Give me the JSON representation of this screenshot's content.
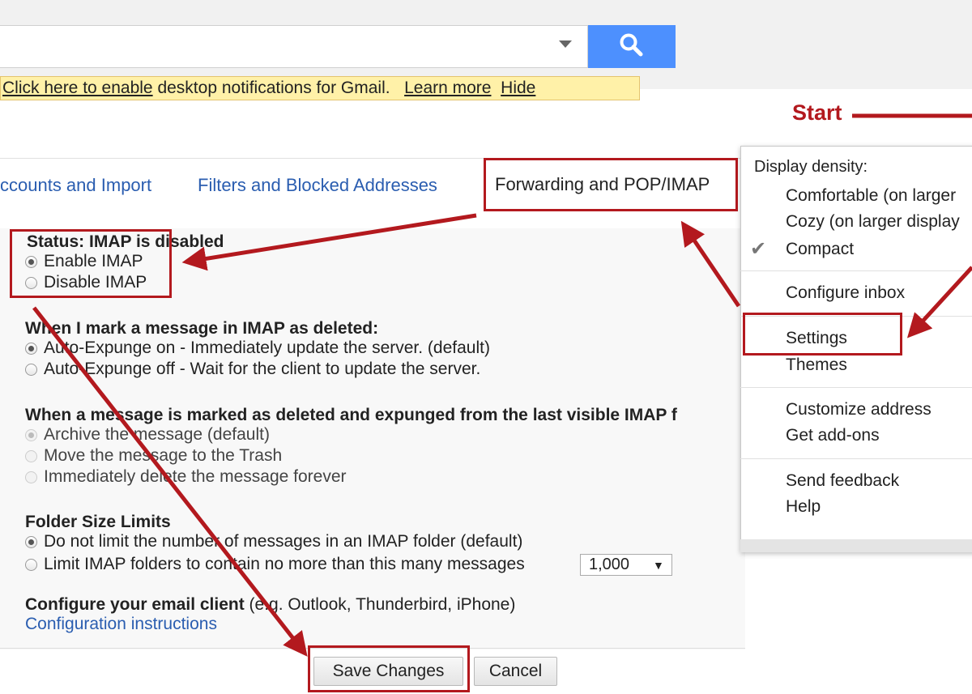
{
  "search": {
    "placeholder": "",
    "dropdown_icon": "chevron-down-icon",
    "button_icon": "search-icon",
    "accent": "#4d90fe"
  },
  "notification": {
    "enable_link": "Click here to enable",
    "text": " desktop notifications for Gmail.",
    "learn_more": "Learn more",
    "hide": "Hide"
  },
  "tabs": {
    "accounts": "ccounts and Import",
    "filters": "Filters and Blocked Addresses",
    "forwarding": "Forwarding and POP/IMAP"
  },
  "imap": {
    "status": "Status: IMAP is disabled",
    "enable": "Enable IMAP",
    "disable": "Disable IMAP",
    "selected": "enable"
  },
  "deleted": {
    "title": "When I mark a message in IMAP as deleted:",
    "options": [
      "Auto-Expunge on - Immediately update the server. (default)",
      "Auto-Expunge off - Wait for the client to update the server."
    ]
  },
  "expunged": {
    "title": "When a message is marked as deleted and expunged from the last visible IMAP f",
    "options": [
      "Archive the message (default)",
      "Move the message to the Trash",
      "Immediately delete the message forever"
    ]
  },
  "folder_limits": {
    "title": "Folder Size Limits",
    "options": [
      "Do not limit the number of messages in an IMAP folder (default)",
      "Limit IMAP folders to contain no more than this many messages"
    ],
    "limit_value": "1,000"
  },
  "configure": {
    "title": "Configure your email client",
    "hint": " (e.g. Outlook, Thunderbird, iPhone)",
    "link": "Configuration instructions"
  },
  "buttons": {
    "save": "Save Changes",
    "cancel": "Cancel"
  },
  "menu": {
    "density_label": "Display density:",
    "density_options": [
      "Comfortable (on larger",
      "Cozy (on larger display",
      "Compact"
    ],
    "selected_density": "Compact",
    "items": {
      "configure_inbox": "Configure inbox",
      "settings": "Settings",
      "themes": "Themes",
      "customize_address": "Customize address",
      "get_addons": "Get add-ons",
      "send_feedback": "Send feedback",
      "help": "Help"
    }
  },
  "annotation": {
    "start": "Start",
    "color": "#b3191e"
  }
}
